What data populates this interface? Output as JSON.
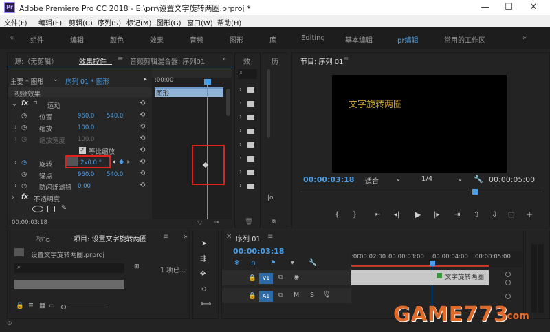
{
  "window": {
    "logo": "Pr",
    "title": "Adobe Premiere Pro CC 2018 - E:\\prr\\设置文字旋转两圈.prproj *",
    "minimize": "—",
    "maximize": "☐",
    "close": "✕"
  },
  "menu": [
    "文件(F)",
    "编辑(E)",
    "剪辑(C)",
    "序列(S)",
    "标记(M)",
    "图形(G)",
    "窗口(W)",
    "帮助(H)"
  ],
  "workspaces": {
    "left_arrow": "«",
    "items": [
      "组件",
      "编辑",
      "颜色",
      "效果",
      "音频",
      "图形",
      "库",
      "Editing",
      "基本编辑",
      "pr编辑",
      "常用的工作区"
    ],
    "active": "pr编辑",
    "more": "»"
  },
  "effect_panel": {
    "tabs": [
      "源:（无剪辑）",
      "效果控件",
      "音频剪辑混合器: 序列01"
    ],
    "more": "»",
    "master": "主要 * 图形",
    "sequence": "序列 01 * 图形",
    "section": "视频效果",
    "fx_motion": "运动",
    "position_label": "位置",
    "position_x": "960.0",
    "position_y": "540.0",
    "scale_label": "缩放",
    "scale_value": "100.0",
    "scale_width_label": "缩放宽度",
    "scale_width_value": "100.0",
    "uniform_scale_label": "等比缩放",
    "rotation_label": "旋转",
    "rotation_value": "2x0.0 °",
    "anchor_label": "锚点",
    "anchor_x": "960.0",
    "anchor_y": "540.0",
    "antiflicker_label": "防闪烁滤镜",
    "antiflicker_value": "0.00",
    "opacity_label": "不透明度",
    "timecode": "00:00:03:18",
    "timeline_ruler": ":00:00",
    "clip_label": "图形"
  },
  "effects_narrow": {
    "tab1": "效",
    "tab2": "历"
  },
  "program": {
    "title": "节目: 序列 01",
    "overlay_text": "文字旋转两圈",
    "timecode": "00:00:03:18",
    "fit": "适合",
    "resolution": "1/4",
    "duration": "00:00:05:00"
  },
  "project": {
    "tabs": [
      "标记",
      "项目: 设置文字旋转两圈"
    ],
    "more": "»",
    "file": "设置文字旋转两圈.prproj",
    "items_count": "1 项已..."
  },
  "timeline": {
    "title": "序列 01",
    "timecode": "00:00:03:18",
    "ruler": [
      "00:02:00",
      "00:00:03:00",
      "00:00:04:00",
      "00:00:05:00"
    ],
    "ruler_prefix": ":00",
    "v1": "V1",
    "a1": "A1",
    "clip_label": "文字旋转两圈",
    "m": "M",
    "s": "S"
  },
  "watermark": {
    "text": "GAME773",
    "suffix": ".com"
  },
  "colors": {
    "accent": "#4a9fe8",
    "red": "#e0201c",
    "clip": "#d8d8d8",
    "gold": "#c8a030"
  }
}
